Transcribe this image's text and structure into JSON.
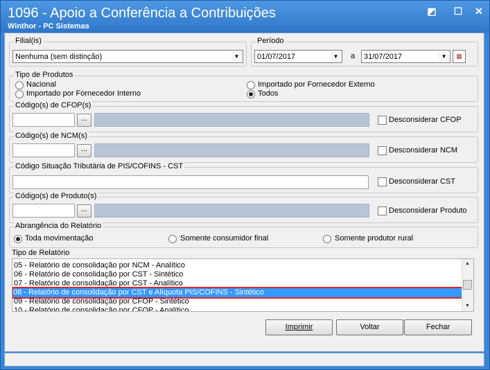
{
  "window": {
    "title": "1096 - Apoio a Conferência a Contribuições",
    "subtitle": "Winthor - PC Sistemas"
  },
  "filial": {
    "legend": "Filial(is)",
    "value": "Nenhuma (sem distinção)"
  },
  "periodo": {
    "legend": "Período",
    "start": "01/07/2017",
    "sep": "a",
    "end": "31/07/2017"
  },
  "tipo_produtos": {
    "legend": "Tipo de Produtos",
    "options": [
      "Nacional",
      "Importado por Fornecedor Interno",
      "Importado por Fornecedor Externo",
      "Todos"
    ],
    "selected": "Todos"
  },
  "cfop": {
    "legend": "Código(s) de CFOP(s)",
    "check": "Desconsiderar CFOP",
    "dots": "..."
  },
  "ncm": {
    "legend": "Código(s) de NCM(s)",
    "check": "Desconsiderar NCM",
    "dots": "..."
  },
  "cst": {
    "legend": "Código Situação Tributária de PIS/COFINS - CST",
    "check": "Desconsiderar CST"
  },
  "produto": {
    "legend": "Código(s) de Produto(s)",
    "check": "Desconsiderar Produto",
    "dots": "..."
  },
  "abrangencia": {
    "legend": "Abrangência do Relatório",
    "options": [
      "Toda movimentação",
      "Somente consumidor final",
      "Somente produtor rural"
    ],
    "selected": "Toda movimentação"
  },
  "tipo_relatorio": {
    "legend": "Tipo de Relatório",
    "items": [
      "05 - Relatório de consolidação por NCM - Analítico",
      "06 - Relatório de consolidação por CST - Sintético",
      "07 - Relatório de consolidação por CST - Analítico",
      "08 - Relatório de consolidação por CST e Alíquota PIS/COFINS - Sintético",
      "09 - Relatório de consolidação por CFOP - Sintético",
      "10 - Relatório de consolidação por CFOP - Analítico"
    ],
    "selected_index": 3
  },
  "buttons": {
    "imprimir": "Imprimir",
    "voltar": "Voltar",
    "fechar": "Fechar"
  }
}
